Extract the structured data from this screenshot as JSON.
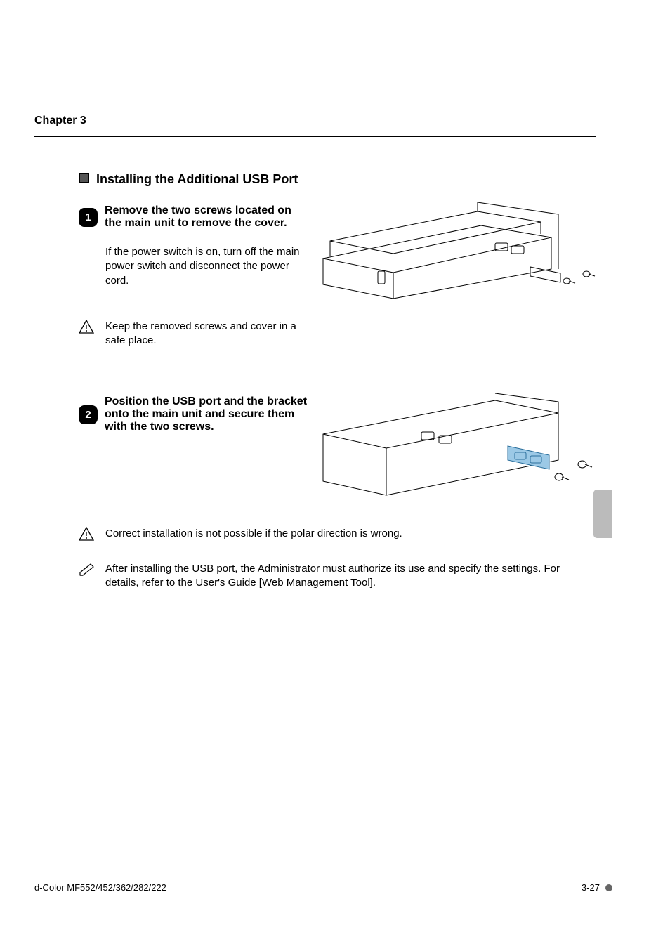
{
  "header": {
    "chapter": "Chapter 3"
  },
  "section": {
    "title": "Installing the Additional USB Port",
    "step1": {
      "num": "1",
      "title": "Remove the two screws located on the main unit to remove the cover.",
      "body": "If the power switch is on, turn off the main power switch and disconnect the power cord.",
      "warning": "Keep the removed screws and cover in a safe place."
    },
    "step2": {
      "num": "2",
      "title": "Position the USB port and the bracket onto the main unit and secure them with the two screws.",
      "warning": "Correct installation is not possible if the polar direction is wrong.",
      "note": "After installing the USB port, the Administrator must authorize its use and specify the settings. For details, refer to the User's Guide [Web Management Tool]."
    }
  },
  "footer": {
    "product": "d-Color MF552/452/362/282/222",
    "page": "3-27"
  }
}
